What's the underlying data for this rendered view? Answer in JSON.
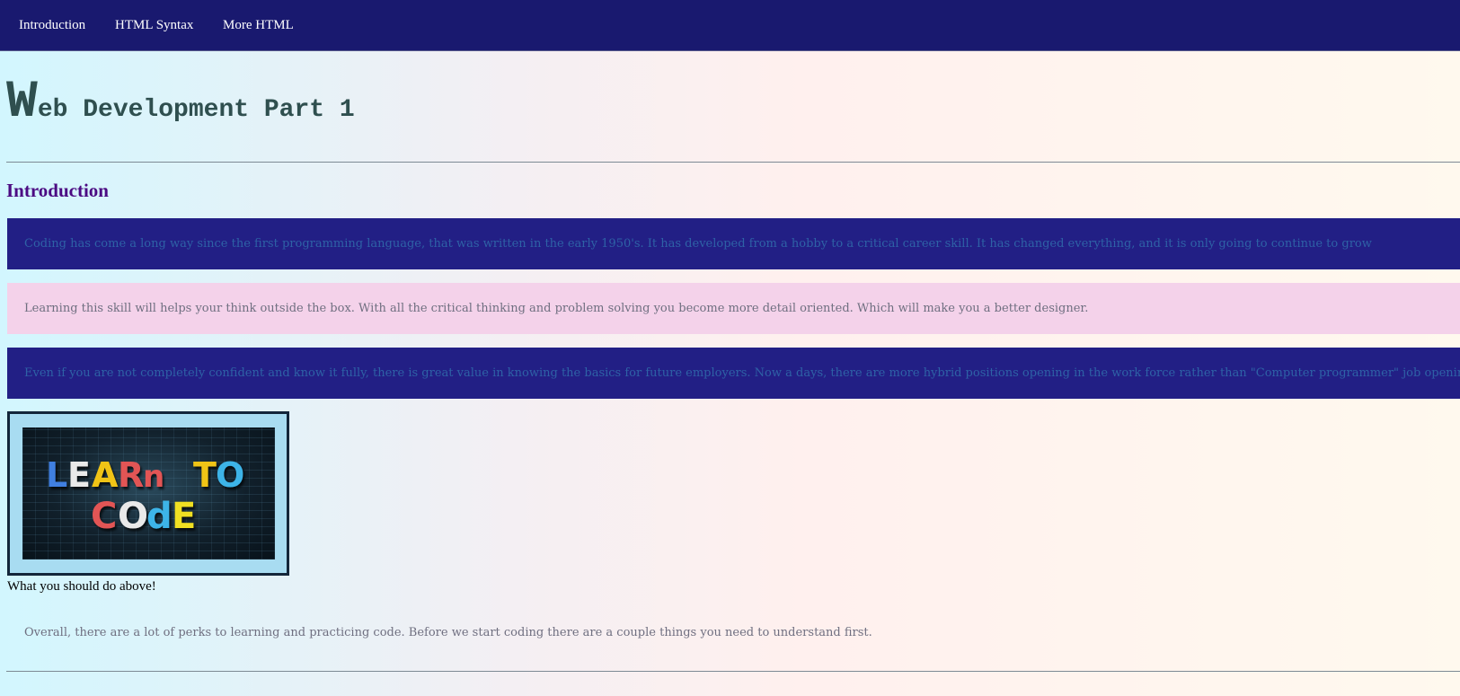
{
  "nav": {
    "items": [
      {
        "label": "Introduction"
      },
      {
        "label": "HTML Syntax"
      },
      {
        "label": "More HTML"
      }
    ]
  },
  "header": {
    "title_first_letter": "W",
    "title_rest": "eb Development Part 1"
  },
  "intro": {
    "heading": "Introduction",
    "paragraphs": [
      "Coding has come a long way since the first programming language, that was written in the early 1950's. It has developed from a hobby to a critical career skill. It has changed everything, and it is only going to continue to grow",
      "Learning this skill will helps your think outside the box. With all the critical thinking and problem solving you become more detail oriented. Which will make you a better designer.",
      "Even if you are not completely confident and know it fully, there is great value in knowing the basics for future employers. Now a days, there are more hybrid positions opening in the work force rather than \"Computer programmer\" job openings."
    ],
    "image": {
      "line1": "LEARn TO",
      "line2": "COdE"
    },
    "caption": "What you should do above!",
    "closing": "Overall, there are a lot of perks to learning and practicing code. Before we start coding there are a couple things you need to understand first."
  },
  "colors": {
    "nav_bg": "#19196f",
    "title": "#2f4f4f",
    "heading": "#4b0a82",
    "dark_panel": "#221f85",
    "pink_panel": "#f4d2ea"
  }
}
